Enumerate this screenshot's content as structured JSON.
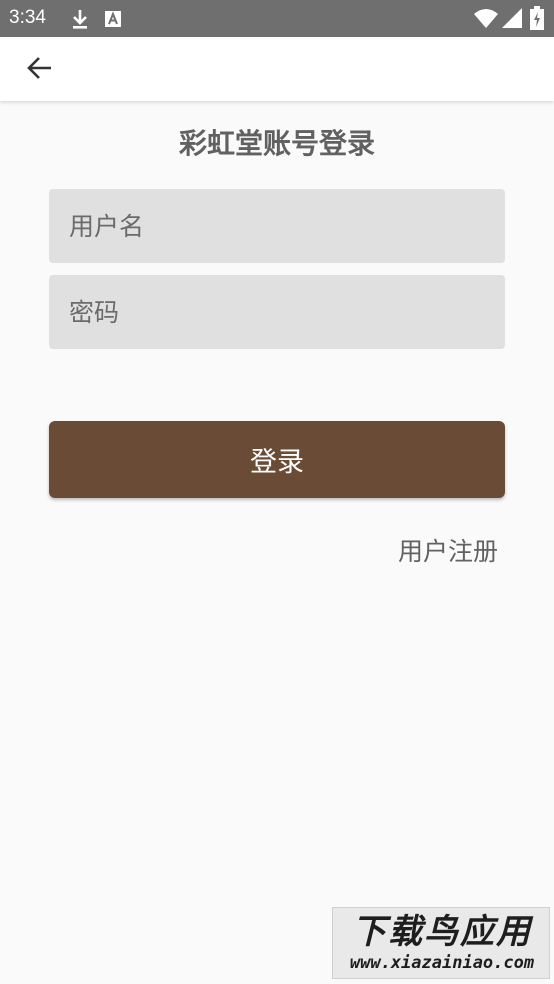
{
  "status_bar": {
    "time": "3:34",
    "icons": [
      "download-icon",
      "font-icon",
      "wifi-icon",
      "signal-icon",
      "battery-icon"
    ]
  },
  "app_bar": {
    "back_icon": "arrow-back-icon"
  },
  "title": "彩虹堂账号登录",
  "form": {
    "username_placeholder": "用户名",
    "username_value": "",
    "password_placeholder": "密码",
    "password_value": ""
  },
  "login_button_label": "登录",
  "register_link_label": "用户注册",
  "watermark": {
    "logo_text": "下载鸟应用",
    "url": "www.xiazainiao.com"
  },
  "colors": {
    "status_bar": "#6f6f6f",
    "primary_button": "#6a4c36",
    "field_background": "#e0e0e0",
    "page_background": "#fafafa"
  }
}
